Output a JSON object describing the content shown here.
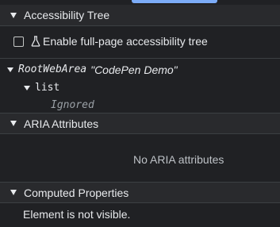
{
  "sections": {
    "accessibility_tree": {
      "title": "Accessibility Tree"
    },
    "aria_attributes": {
      "title": "ARIA Attributes",
      "empty_message": "No ARIA attributes"
    },
    "computed_properties": {
      "title": "Computed Properties",
      "message": "Element is not visible."
    }
  },
  "accessibility_tree": {
    "enable_checkbox_label": "Enable full-page accessibility tree",
    "enable_checked": false,
    "nodes": [
      {
        "role": "RootWebArea",
        "name": "\"CodePen Demo\""
      },
      {
        "role": "list"
      },
      {
        "status": "Ignored"
      }
    ]
  },
  "colors": {
    "background": "#202124",
    "header_background": "#292a2d",
    "text": "#e8eaed",
    "muted_text": "#9aa0a6",
    "accent": "#7cacf8"
  },
  "icons": [
    "triangle-down-icon",
    "checkbox-icon",
    "flask-icon"
  ]
}
